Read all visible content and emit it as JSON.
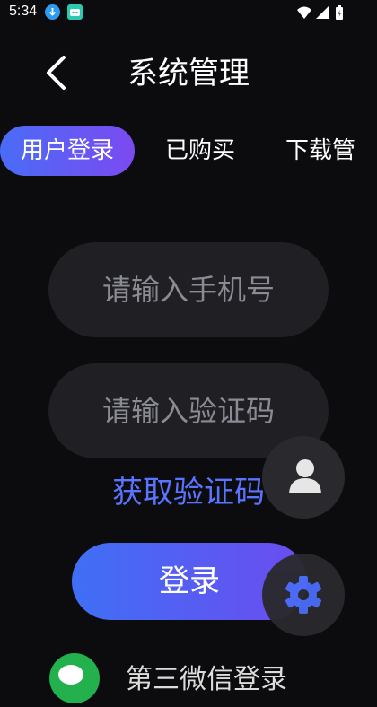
{
  "status_bar": {
    "time": "5:34"
  },
  "header": {
    "title": "系统管理"
  },
  "tabs": [
    {
      "label": "用户登录",
      "active": true
    },
    {
      "label": "已购买",
      "active": false
    },
    {
      "label": "下载管",
      "active": false
    }
  ],
  "form": {
    "phone_placeholder": "请输入手机号",
    "code_placeholder": "请输入验证码",
    "get_code_label": "获取验证码",
    "login_label": "登录"
  },
  "wechat": {
    "label": "第三微信登录"
  },
  "colors": {
    "accent": "#5b74ff",
    "gradient_start": "#3f6ff5",
    "gradient_end": "#6c4cf0",
    "background": "#0c0c0e",
    "field": "#1f1f24",
    "wechat_green": "#22b14c"
  },
  "icons": [
    "download-icon",
    "app-icon",
    "wifi-icon",
    "signal-icon",
    "battery-icon",
    "back-chevron-icon",
    "user-icon",
    "gear-icon",
    "wechat-icon"
  ]
}
